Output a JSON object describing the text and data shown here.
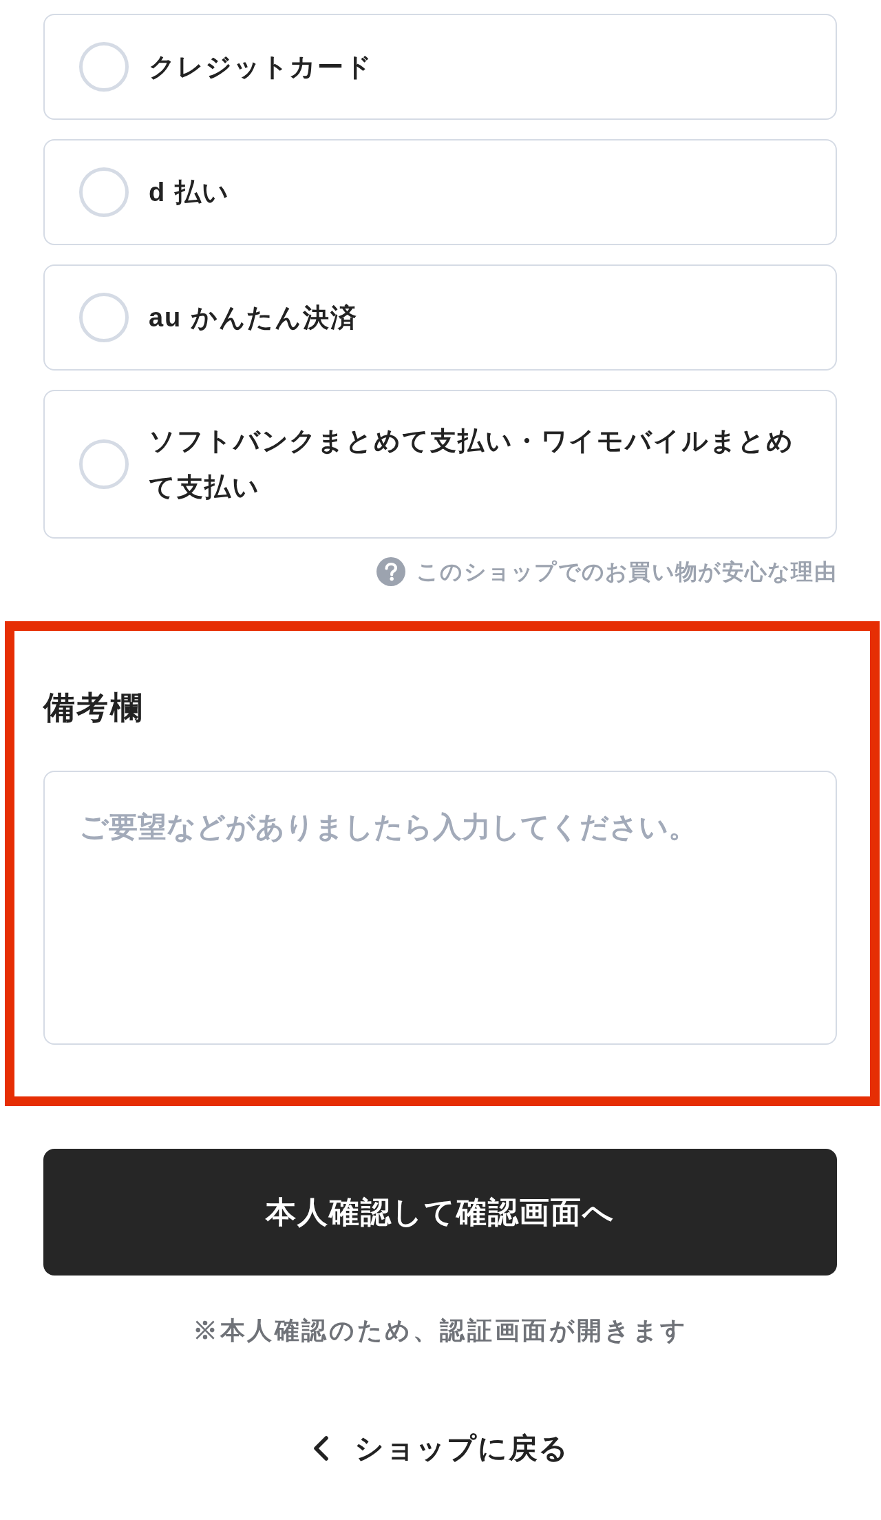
{
  "payment_methods": [
    {
      "label": "クレジットカード",
      "selected": false
    },
    {
      "label": "d 払い",
      "selected": false
    },
    {
      "label": "au かんたん決済",
      "selected": false
    },
    {
      "label": "ソフトバンクまとめて支払い・ワイモバイルまとめて支払い",
      "selected": false
    }
  ],
  "help_link": {
    "label": "このショップでのお買い物が安心な理由"
  },
  "remarks": {
    "title": "備考欄",
    "placeholder": "ご要望などがありましたら入力してください。",
    "highlighted": true
  },
  "submit_button": {
    "label": "本人確認して確認画面へ"
  },
  "note": "※本人確認のため、認証画面が開きます",
  "back_link": {
    "label": "ショップに戻る"
  }
}
